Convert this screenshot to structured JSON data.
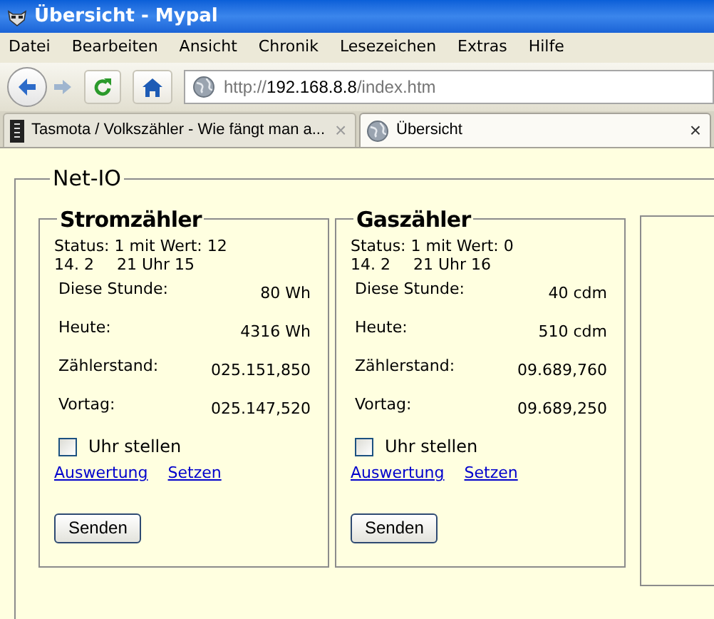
{
  "window": {
    "title": "Übersicht - Mypal"
  },
  "menu": [
    {
      "label": "Datei"
    },
    {
      "label": "Bearbeiten"
    },
    {
      "label": "Ansicht"
    },
    {
      "label": "Chronik"
    },
    {
      "label": "Lesezeichen"
    },
    {
      "label": "Extras"
    },
    {
      "label": "Hilfe"
    }
  ],
  "toolbar": {
    "forward_disabled": true
  },
  "address": {
    "prefix": "http://",
    "host": "192.168.8.8",
    "path": "/index.htm"
  },
  "tabs": [
    {
      "label": "Tasmota / Volkszähler - Wie fängt man a...",
      "close": "×",
      "kind": "document",
      "selected": false
    },
    {
      "label": "Übersicht",
      "close": "×",
      "kind": "web",
      "selected": true
    }
  ],
  "page": {
    "legend": "Net-IO",
    "meters": [
      {
        "title": "Stromzähler",
        "status": "Status: 1 mit Wert: 12",
        "date": "14. 2",
        "time": "21 Uhr 15",
        "rows": [
          {
            "label": "Diese Stunde:",
            "value": "80 Wh"
          },
          {
            "label": "Heute:",
            "value": "4316 Wh"
          },
          {
            "label": "Zählerstand:",
            "value": "025.151,850"
          },
          {
            "label": "Vortag:",
            "value": "025.147,520"
          }
        ],
        "checkbox": {
          "label": "Uhr stellen",
          "checked": false
        },
        "links": [
          "Auswertung",
          "Setzen"
        ],
        "button": "Senden"
      },
      {
        "title": "Gaszähler",
        "status": "Status: 1 mit Wert: 0",
        "date": "14. 2",
        "time": "21 Uhr 16",
        "rows": [
          {
            "label": "Diese Stunde:",
            "value": "40 cdm"
          },
          {
            "label": "Heute:",
            "value": "510 cdm"
          },
          {
            "label": "Zählerstand:",
            "value": "09.689,760"
          },
          {
            "label": "Vortag:",
            "value": "09.689,250"
          }
        ],
        "checkbox": {
          "label": "Uhr stellen",
          "checked": false
        },
        "links": [
          "Auswertung",
          "Setzen"
        ],
        "button": "Senden"
      }
    ]
  }
}
